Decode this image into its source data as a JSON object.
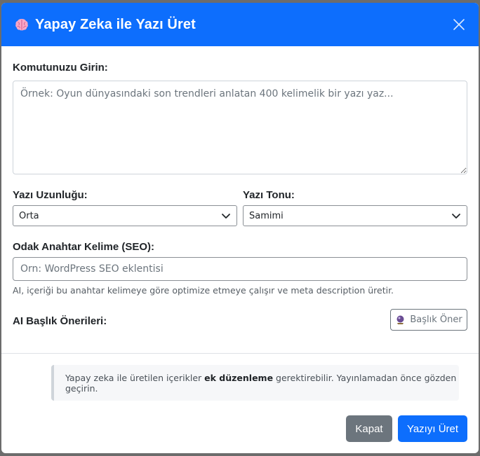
{
  "modal": {
    "title": "Yapay Zeka ile Yazı Üret",
    "title_icon": "brain-icon",
    "close_icon": "close-icon"
  },
  "prompt": {
    "label": "Komutunuzu Girin:",
    "placeholder": "Örnek: Oyun dünyasındaki son trendleri anlatan 400 kelimelik bir yazı yaz...",
    "value": ""
  },
  "length": {
    "label": "Yazı Uzunluğu:",
    "selected": "Orta"
  },
  "tone": {
    "label": "Yazı Tonu:",
    "selected": "Samimi"
  },
  "keyword": {
    "label": "Odak Anahtar Kelime (SEO):",
    "placeholder": "Örn: WordPress SEO eklentisi",
    "value": "",
    "help": "AI, içeriği bu anahtar kelimeye göre optimize etmeye çalışır ve meta description üretir."
  },
  "titles": {
    "label": "AI Başlık Önerileri:",
    "suggest_button": "Başlık Öner",
    "suggest_icon": "crystal-ball-icon"
  },
  "notice": {
    "before": "Yapay zeka ile üretilen içerikler ",
    "bold": "ek düzenleme",
    "after": " gerektirebilir. Yayınlamadan önce gözden geçirin."
  },
  "footer": {
    "close_label": "Kapat",
    "generate_label": "Yazıyı Üret"
  },
  "colors": {
    "header_bg": "#0d6efd",
    "primary": "#0d6efd",
    "secondary": "#6c757d"
  }
}
